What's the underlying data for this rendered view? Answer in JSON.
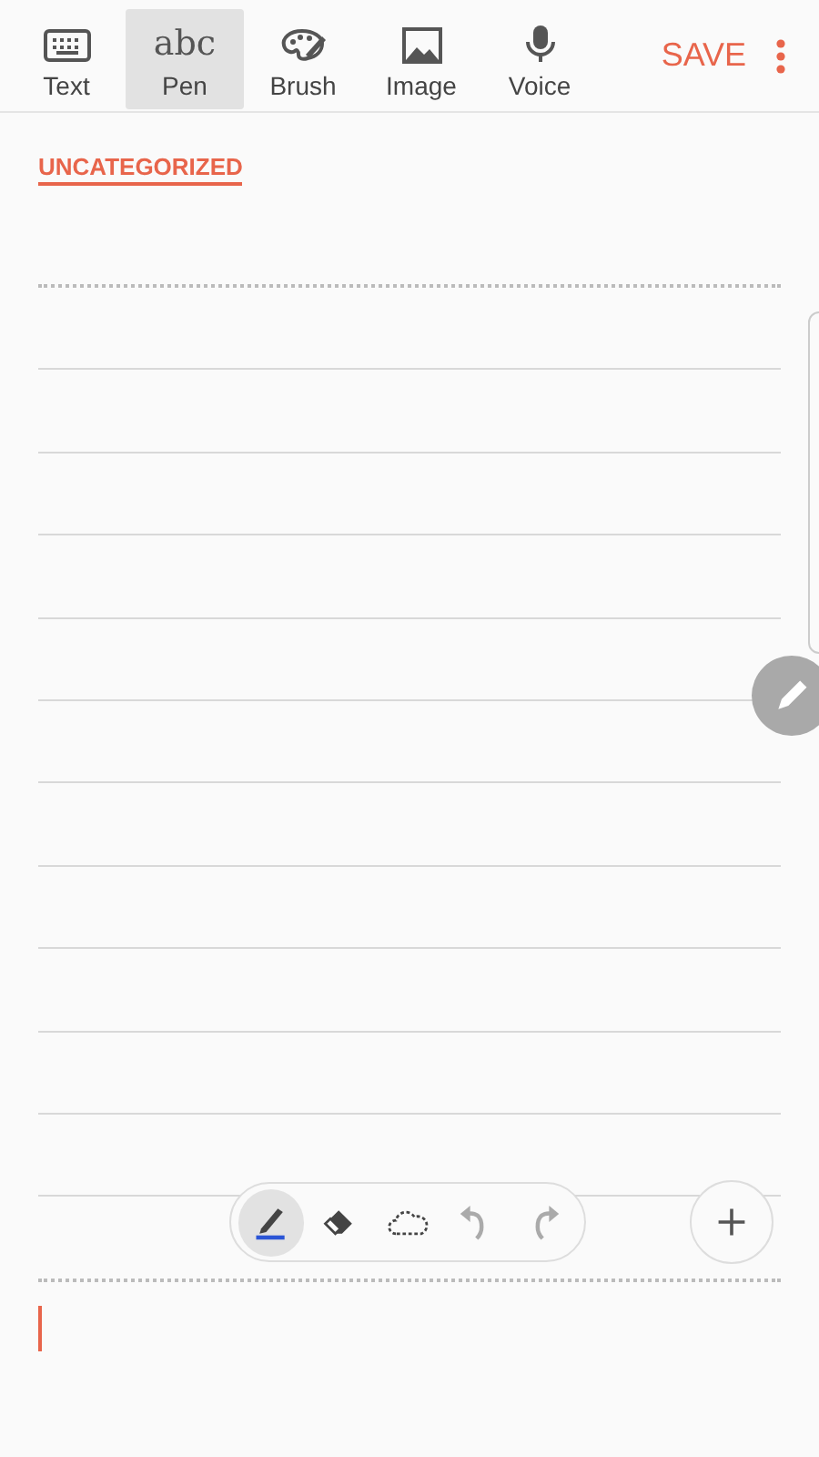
{
  "tabs": [
    {
      "kind": "keyboard",
      "label": "Text",
      "selected": false
    },
    {
      "kind": "handwriting",
      "glyph": "abc",
      "label": "Pen",
      "selected": true
    },
    {
      "kind": "palette",
      "label": "Brush",
      "selected": false
    },
    {
      "kind": "image",
      "label": "Image",
      "selected": false
    },
    {
      "kind": "mic",
      "label": "Voice",
      "selected": false
    }
  ],
  "save": "SAVE",
  "category": "UNCATEGORIZED",
  "pen_tools": [
    {
      "kind": "pen",
      "selected": true,
      "disabled": false
    },
    {
      "kind": "eraser",
      "selected": false,
      "disabled": false
    },
    {
      "kind": "lasso",
      "selected": false,
      "disabled": false
    },
    {
      "kind": "undo",
      "selected": false,
      "disabled": true
    },
    {
      "kind": "redo",
      "selected": false,
      "disabled": true
    }
  ]
}
